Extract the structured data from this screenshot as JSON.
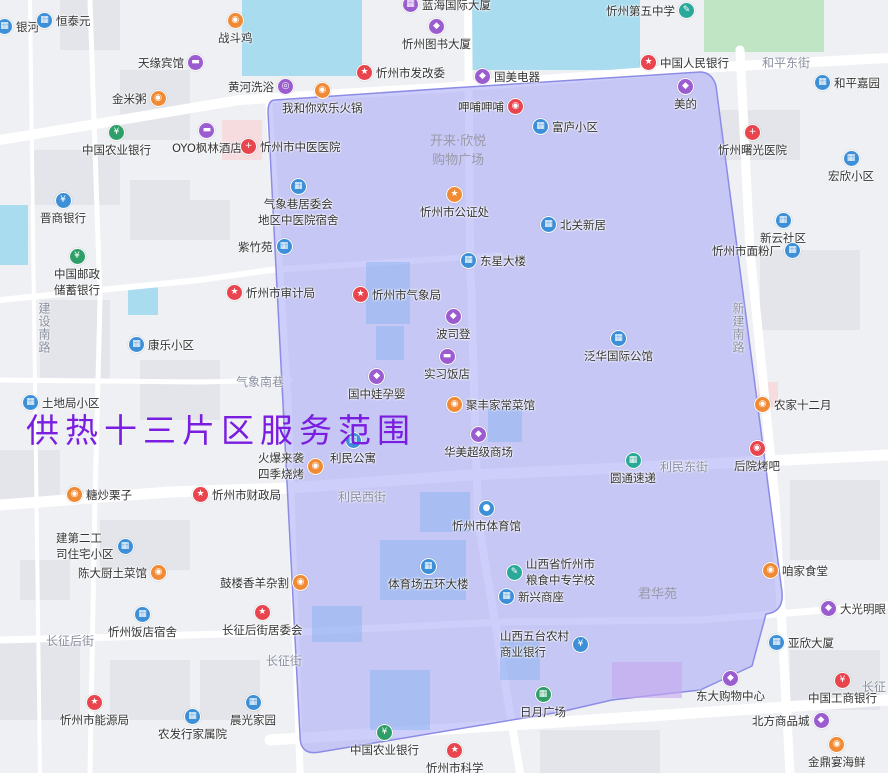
{
  "zone": {
    "title": "供热十三片区服务范围",
    "fill": "#a6a6f5",
    "stroke": "#8c8ce6"
  },
  "streets": {
    "hepingdong": "和平东街",
    "xinjian_nan": "新建南路",
    "qixiangnan": "气象南巷",
    "limindong": "利民东街",
    "liminxi": "利民西街",
    "changzheng_hou": "长征后街",
    "changzheng": "长征街",
    "jianshenan": "建设南路",
    "changzheng2": "长征"
  },
  "areas": {
    "kailai": "开来·欣悦\n购物广场",
    "junhua": "君华苑"
  },
  "pois": [
    {
      "id": "yinhe",
      "label": "银河",
      "icon": "building",
      "color": "blue"
    },
    {
      "id": "hengtaiyuan",
      "label": "恒泰元",
      "icon": "building",
      "color": "blue"
    },
    {
      "id": "zhandouji",
      "label": "战斗鸡",
      "icon": "food",
      "color": "orange"
    },
    {
      "id": "lanhai",
      "label": "蓝海国际大厦",
      "icon": "building",
      "color": "purple"
    },
    {
      "id": "wuzhong",
      "label": "忻州第五中学",
      "icon": "school",
      "color": "teal"
    },
    {
      "id": "tuhuabinguan",
      "label": "天缘宾馆",
      "icon": "hotel",
      "color": "purple"
    },
    {
      "id": "tushuguan",
      "label": "忻州图书大厦",
      "icon": "shop",
      "color": "purple"
    },
    {
      "id": "huanghexiyu",
      "label": "黄河洗浴",
      "icon": "leisure",
      "color": "purple"
    },
    {
      "id": "fagaiwei",
      "label": "忻州市发改委",
      "icon": "gov",
      "color": "red"
    },
    {
      "id": "guomei",
      "label": "国美电器",
      "icon": "shop",
      "color": "purple"
    },
    {
      "id": "renminyh",
      "label": "中国人民银行",
      "icon": "gov",
      "color": "red"
    },
    {
      "id": "hepingjiayuan",
      "label": "和平嘉园",
      "icon": "building",
      "color": "blue"
    },
    {
      "id": "jinmizhou",
      "label": "金米粥",
      "icon": "food",
      "color": "orange"
    },
    {
      "id": "wohehuoguo",
      "label": "我和你欢乐火锅",
      "icon": "food",
      "color": "orange"
    },
    {
      "id": "huahua",
      "label": "呷哺呷哺",
      "icon": "food",
      "color": "red"
    },
    {
      "id": "meide",
      "label": "美的",
      "icon": "shop",
      "color": "purple"
    },
    {
      "id": "nongyeyh1",
      "label": "中国农业银行",
      "icon": "bank",
      "color": "green"
    },
    {
      "id": "oyo",
      "label": "OYO枫林酒店",
      "icon": "hotel",
      "color": "purple"
    },
    {
      "id": "zhongyiyy",
      "label": "忻州市中医医院",
      "icon": "hospital",
      "color": "red"
    },
    {
      "id": "fulu",
      "label": "富庐小区",
      "icon": "building",
      "color": "blue"
    },
    {
      "id": "shuguang",
      "label": "忻州曙光医院",
      "icon": "hospital",
      "color": "red"
    },
    {
      "id": "hongxin",
      "label": "宏欣小区",
      "icon": "building",
      "color": "blue"
    },
    {
      "id": "qixiangxiang",
      "label": "气象巷居委会\n地区中医院宿舍",
      "icon": "building",
      "color": "blue"
    },
    {
      "id": "gongzheng",
      "label": "忻州市公证处",
      "icon": "gov",
      "color": "orange"
    },
    {
      "id": "jinshangyh",
      "label": "晋商银行",
      "icon": "bank",
      "color": "blue"
    },
    {
      "id": "beiguan",
      "label": "北关新居",
      "icon": "building",
      "color": "blue"
    },
    {
      "id": "xinyun",
      "label": "新云社区",
      "icon": "building",
      "color": "blue"
    },
    {
      "id": "ziyuan",
      "label": "紫竹苑",
      "icon": "building",
      "color": "blue"
    },
    {
      "id": "dongxing",
      "label": "东星大楼",
      "icon": "building",
      "color": "blue"
    },
    {
      "id": "mianfen",
      "label": "忻州市面粉厂",
      "icon": "building",
      "color": "blue"
    },
    {
      "id": "youzheng",
      "label": "中国邮政\n储蓄银行",
      "icon": "bank",
      "color": "green"
    },
    {
      "id": "shenji",
      "label": "忻州市审计局",
      "icon": "gov",
      "color": "red"
    },
    {
      "id": "qixiangju",
      "label": "忻州市气象局",
      "icon": "gov",
      "color": "red"
    },
    {
      "id": "bosideng",
      "label": "波司登",
      "icon": "shop",
      "color": "purple"
    },
    {
      "id": "kangle",
      "label": "康乐小区",
      "icon": "building",
      "color": "blue"
    },
    {
      "id": "fanhua",
      "label": "泛华国际公馆",
      "icon": "building",
      "color": "blue"
    },
    {
      "id": "shixi",
      "label": "实习饭店",
      "icon": "hotel",
      "color": "purple"
    },
    {
      "id": "guozhong",
      "label": "国中娃孕婴",
      "icon": "shop",
      "color": "purple"
    },
    {
      "id": "jufeng",
      "label": "聚丰家常菜馆",
      "icon": "food",
      "color": "orange"
    },
    {
      "id": "tudiju",
      "label": "土地局小区",
      "icon": "building",
      "color": "blue"
    },
    {
      "id": "nongjia",
      "label": "农家十二月",
      "icon": "food",
      "color": "orange"
    },
    {
      "id": "huobao",
      "label": "火爆来袭\n四季烧烤",
      "icon": "food",
      "color": "orange"
    },
    {
      "id": "limingongyu",
      "label": "利民公寓",
      "icon": "building",
      "color": "blue"
    },
    {
      "id": "huamei",
      "label": "华美超级商场",
      "icon": "shop",
      "color": "purple"
    },
    {
      "id": "yuandi",
      "label": "圆通速递",
      "icon": "building",
      "color": "teal"
    },
    {
      "id": "houyuan",
      "label": "后院烤吧",
      "icon": "food",
      "color": "red"
    },
    {
      "id": "tangchao",
      "label": "糖炒栗子",
      "icon": "food",
      "color": "orange"
    },
    {
      "id": "caizheng",
      "label": "忻州市财政局",
      "icon": "gov",
      "color": "red"
    },
    {
      "id": "tiyuguan",
      "label": "忻州市体育馆",
      "icon": "sport",
      "color": "blue"
    },
    {
      "id": "zhuzhai2",
      "label": "建第二工\n司住宅小区",
      "icon": "building",
      "color": "blue"
    },
    {
      "id": "liangshi",
      "label": "山西省忻州市\n粮食中专学校",
      "icon": "school",
      "color": "teal"
    },
    {
      "id": "zanjia",
      "label": "咱家食堂",
      "icon": "food",
      "color": "orange"
    },
    {
      "id": "chenda",
      "label": "陈大厨土菜馆",
      "icon": "food",
      "color": "orange"
    },
    {
      "id": "gulou",
      "label": "鼓楼香羊杂割",
      "icon": "food",
      "color": "orange"
    },
    {
      "id": "wuhuan",
      "label": "体育场五环大楼",
      "icon": "building",
      "color": "blue"
    },
    {
      "id": "xinxing",
      "label": "新兴商座",
      "icon": "building",
      "color": "blue"
    },
    {
      "id": "daguangming",
      "label": "大光明眼",
      "icon": "shop",
      "color": "purple"
    },
    {
      "id": "fandian",
      "label": "忻州饭店宿舍",
      "icon": "building",
      "color": "blue"
    },
    {
      "id": "changzhengjwh",
      "label": "长征后街居委会",
      "icon": "gov",
      "color": "red"
    },
    {
      "id": "wutai",
      "label": "山西五台农村\n商业银行",
      "icon": "bank",
      "color": "blue"
    },
    {
      "id": "yaxin",
      "label": "亚欣大厦",
      "icon": "building",
      "color": "blue"
    },
    {
      "id": "dongda",
      "label": "东大购物中心",
      "icon": "shop",
      "color": "purple"
    },
    {
      "id": "gongshang",
      "label": "中国工商银行",
      "icon": "bank",
      "color": "red"
    },
    {
      "id": "nengyuan",
      "label": "忻州市能源局",
      "icon": "gov",
      "color": "red"
    },
    {
      "id": "nongfa",
      "label": "农发行家属院",
      "icon": "building",
      "color": "blue"
    },
    {
      "id": "chenguang",
      "label": "晨光家园",
      "icon": "building",
      "color": "blue"
    },
    {
      "id": "riyue",
      "label": "日月广场",
      "icon": "building",
      "color": "green"
    },
    {
      "id": "beifang",
      "label": "北方商品城",
      "icon": "shop",
      "color": "purple"
    },
    {
      "id": "nongyeyh2",
      "label": "中国农业银行",
      "icon": "bank",
      "color": "green"
    },
    {
      "id": "kexie",
      "label": "忻州市科学",
      "icon": "gov",
      "color": "red"
    },
    {
      "id": "jinding",
      "label": "金鼎宴海鲜",
      "icon": "food",
      "color": "orange"
    }
  ],
  "icon_glyphs": {
    "building": "▦",
    "food": "◉",
    "gov": "★",
    "bank": "¥",
    "hospital": "+",
    "hotel": "▬",
    "shop": "◆",
    "school": "✎",
    "sport": "●",
    "leisure": "◎"
  }
}
